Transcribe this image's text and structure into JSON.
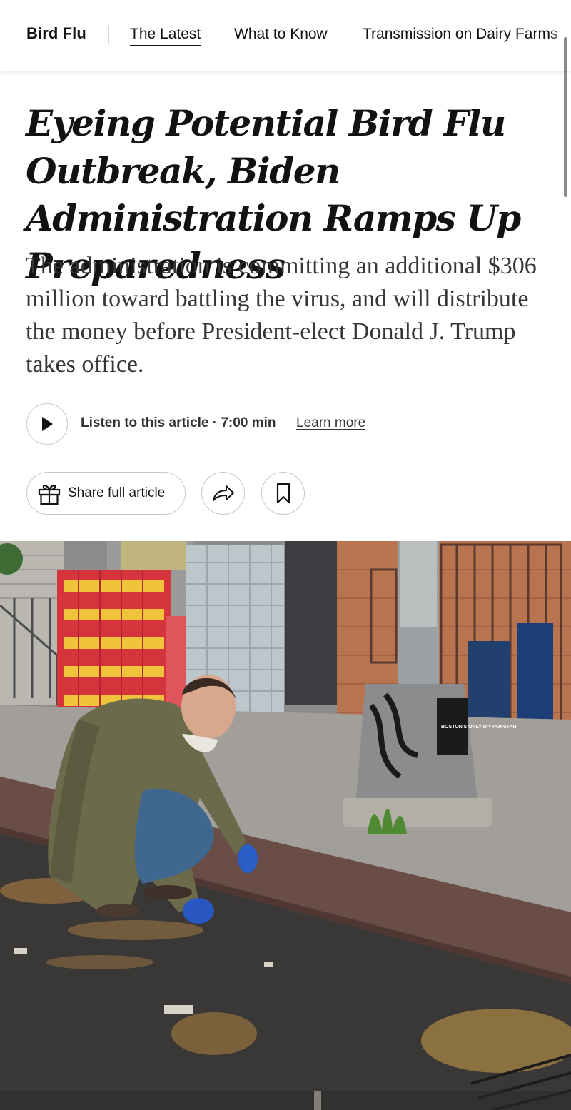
{
  "nav": {
    "section": "Bird Flu",
    "tabs": [
      {
        "label": "The Latest",
        "active": true
      },
      {
        "label": "What to Know",
        "active": false
      },
      {
        "label": "Transmission on Dairy Farms",
        "active": false
      }
    ]
  },
  "article": {
    "headline": "Eyeing Potential Bird Flu Outbreak, Biden Administration Ramps Up Preparedness",
    "summary": "The administration is committing an additional $306 million toward battling the virus, and will distribute the money before President-elect Donald J. Trump takes office."
  },
  "audio": {
    "play_icon": "play-icon",
    "listen_label": "Listen to this article · 7:00 min",
    "learn_more": "Learn more"
  },
  "actions": {
    "share_full_label": "Share full article",
    "gift_icon": "gift-icon",
    "share_icon": "share-arrow-icon",
    "bookmark_icon": "bookmark-icon"
  },
  "photo": {
    "sticker_text": "BOSTON'S ONLY DIY POPSTAR"
  }
}
